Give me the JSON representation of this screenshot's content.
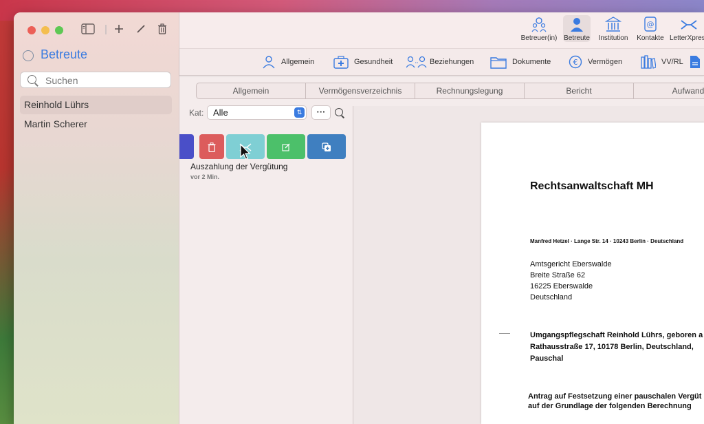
{
  "sidebar": {
    "title": "Betreute",
    "search_placeholder": "Suchen",
    "items": [
      {
        "label": "Reinhold Lührs",
        "selected": true
      },
      {
        "label": "Martin Scherer",
        "selected": false
      }
    ]
  },
  "toolbar": {
    "items": [
      {
        "label": "Betreuer(in)",
        "icon": "people-outline-icon"
      },
      {
        "label": "Betreute",
        "icon": "person-icon",
        "active": true
      },
      {
        "label": "Institution",
        "icon": "institution-icon"
      },
      {
        "label": "Kontakte",
        "icon": "contacts-icon"
      },
      {
        "label": "LetterXpress",
        "icon": "letterxpress-icon"
      }
    ]
  },
  "nav": {
    "items": [
      {
        "label": "Allgemein",
        "icon": "person-outline-icon"
      },
      {
        "label": "Gesundheit",
        "icon": "medkit-icon"
      },
      {
        "label": "Beziehungen",
        "icon": "relations-icon"
      },
      {
        "label": "Dokumente",
        "icon": "folder-icon"
      },
      {
        "label": "Vermögen",
        "icon": "euro-icon"
      },
      {
        "label": "VV/RL",
        "icon": "books-icon"
      },
      {
        "label": "",
        "icon": "document-icon"
      }
    ]
  },
  "tabs": [
    "Allgemein",
    "Vermögensverzeichnis",
    "Rechnungslegung",
    "Bericht",
    "Aufwand"
  ],
  "filter": {
    "label": "Kat:",
    "selected": "Alle",
    "more": "···"
  },
  "entry": {
    "title": "Auszahlung der Vergütung",
    "time": "vor 2 Min."
  },
  "colors": {
    "accent": "#3a7be0",
    "delete": "#dc5c5c",
    "send": "#7fcfd4",
    "edit": "#4cc06a",
    "copy": "#3f7fc0",
    "left_action": "#4a4fc8"
  },
  "letter": {
    "firm": "Rechtsanwaltschaft MH",
    "sender_line": "Manfred Hetzel · Lange Str. 14 · 10243 Berlin · Deutschland",
    "recipient": [
      "Amtsgericht Eberswalde",
      "Breite Straße 62",
      "16225 Eberswalde",
      "Deutschland"
    ],
    "subject": [
      "Umgangspflegschaft Reinhold Lührs, geboren a",
      "Rathausstraße 17, 10178 Berlin, Deutschland,",
      "Pauschal"
    ],
    "request": [
      "Antrag auf Festsetzung einer pauschalen Vergüt",
      "auf der Grundlage der folgenden Berechnung"
    ]
  }
}
